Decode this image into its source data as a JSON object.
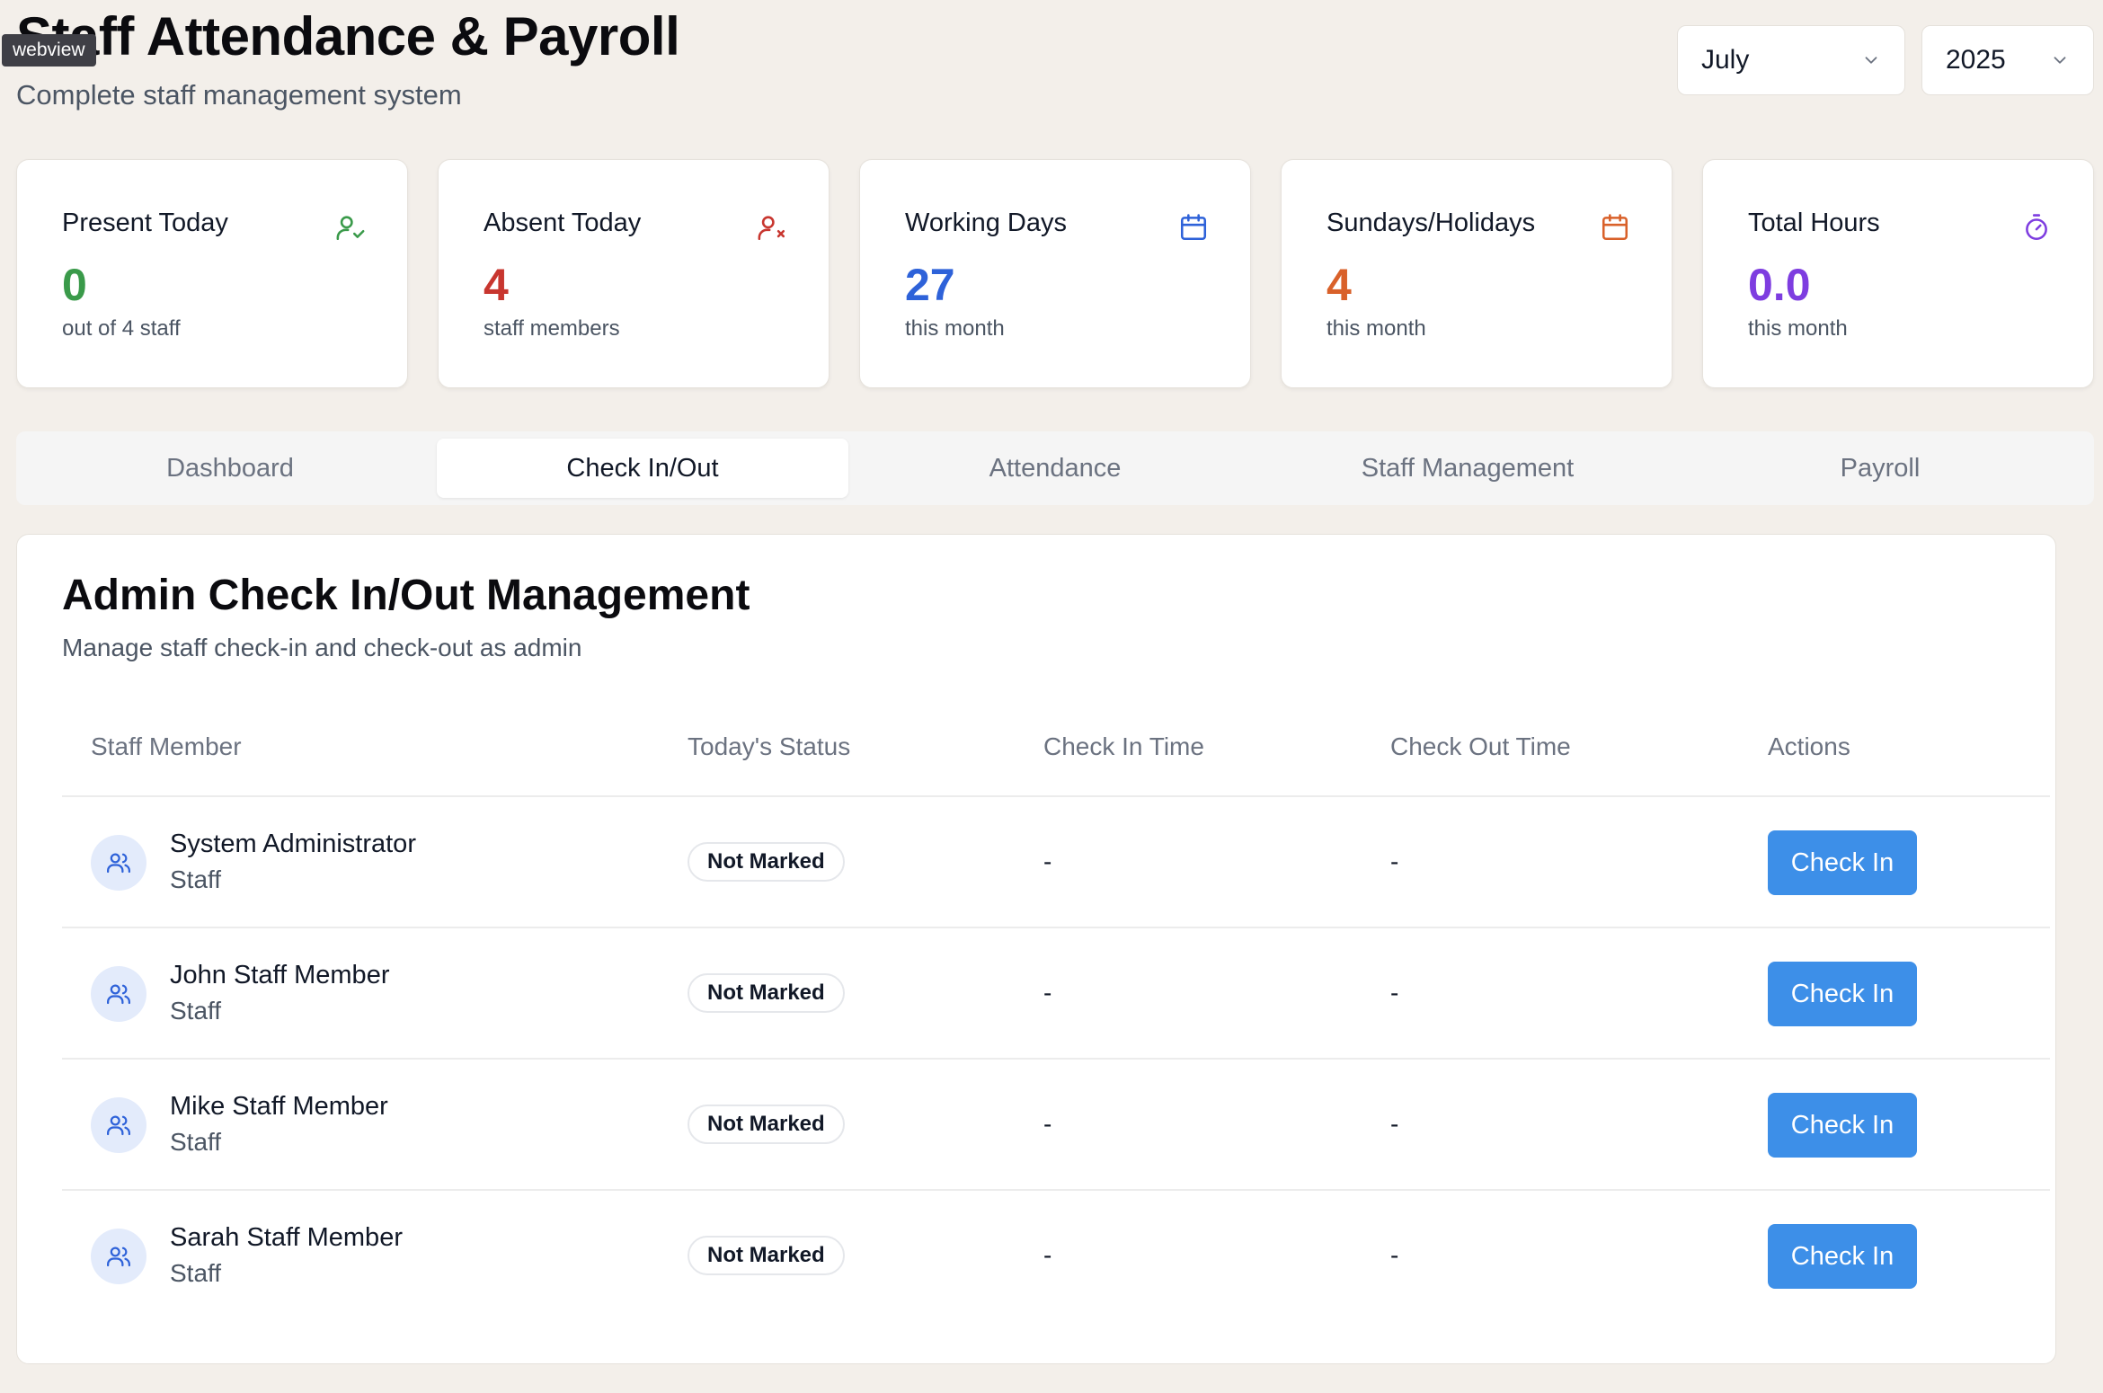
{
  "header": {
    "badge": "webview",
    "title": "Staff Attendance & Payroll",
    "subtitle": "Complete staff management system",
    "month": "July",
    "year": "2025"
  },
  "stats": [
    {
      "label": "Present Today",
      "value": "0",
      "sub": "out of 4 staff",
      "color": "#3a9a4a",
      "icon": "user-check-icon"
    },
    {
      "label": "Absent Today",
      "value": "4",
      "sub": "staff members",
      "color": "#c8362f",
      "icon": "user-x-icon"
    },
    {
      "label": "Working Days",
      "value": "27",
      "sub": "this month",
      "color": "#2e62d9",
      "icon": "calendar-icon"
    },
    {
      "label": "Sundays/Holidays",
      "value": "4",
      "sub": "this month",
      "color": "#d9612a",
      "icon": "calendar-icon"
    },
    {
      "label": "Total Hours",
      "value": "0.0",
      "sub": "this month",
      "color": "#7e3de0",
      "icon": "timer-icon"
    }
  ],
  "tabs": [
    "Dashboard",
    "Check In/Out",
    "Attendance",
    "Staff Management",
    "Payroll"
  ],
  "active_tab": "Check In/Out",
  "panel": {
    "title": "Admin Check In/Out Management",
    "subtitle": "Manage staff check-in and check-out as admin"
  },
  "table": {
    "headers": [
      "Staff Member",
      "Today's Status",
      "Check In Time",
      "Check Out Time",
      "Actions"
    ],
    "rows": [
      {
        "name": "System Administrator",
        "role": "Staff",
        "status": "Not Marked",
        "check_in": "-",
        "check_out": "-",
        "action": "Check In"
      },
      {
        "name": "John Staff Member",
        "role": "Staff",
        "status": "Not Marked",
        "check_in": "-",
        "check_out": "-",
        "action": "Check In"
      },
      {
        "name": "Mike Staff Member",
        "role": "Staff",
        "status": "Not Marked",
        "check_in": "-",
        "check_out": "-",
        "action": "Check In"
      },
      {
        "name": "Sarah Staff Member",
        "role": "Staff",
        "status": "Not Marked",
        "check_in": "-",
        "check_out": "-",
        "action": "Check In"
      }
    ]
  },
  "colors": {
    "background": "#f3efea",
    "button": "#3d8fe8",
    "avatar_bg": "#e3ebfb",
    "avatar_icon": "#2e62d9"
  }
}
